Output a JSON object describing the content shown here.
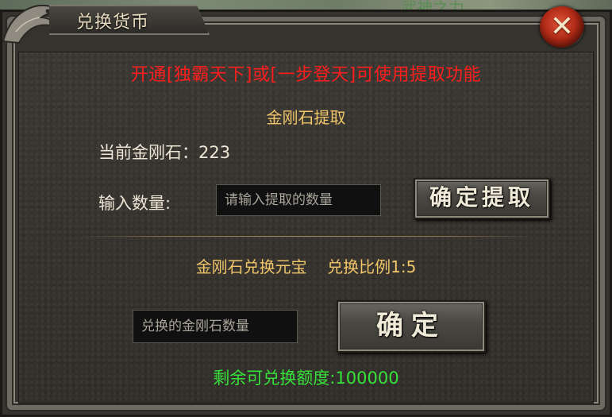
{
  "background": {
    "left_text": "...",
    "right_text": "武神之力"
  },
  "window": {
    "title": "兑换货币",
    "close_symbol": "✕"
  },
  "notice": "开通[独霸天下]或[一步登天]可使用提取功能",
  "extract": {
    "section_title": "金刚石提取",
    "current_label": "当前金刚石：",
    "current_value": "223",
    "quantity_label": "输入数量:",
    "quantity_placeholder": "请输入提取的数量",
    "confirm_button": "确定提取"
  },
  "exchange": {
    "section_title": "金刚石兑换元宝    兑换比例1:5",
    "input_placeholder": "兑换的金刚石数量",
    "confirm_button": "确定",
    "remaining_text": "剩余可兑换额度:100000"
  },
  "colors": {
    "notice_red": "#ff1e1e",
    "section_gold": "#f1c66a",
    "remaining_green": "#36e23a"
  },
  "icons": {
    "close": "close-icon",
    "corner": "dragon-ornament-icon"
  }
}
